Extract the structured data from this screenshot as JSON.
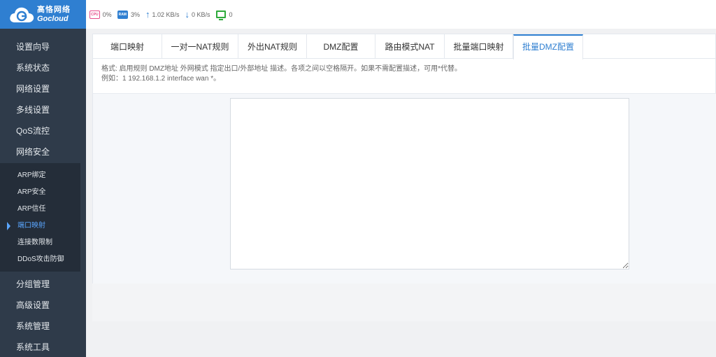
{
  "logo": {
    "cn": "高恪网络",
    "en": "Gocloud"
  },
  "status": {
    "cpu_tag": "CPU",
    "cpu": "0%",
    "ram_tag": "RAM",
    "ram": "3%",
    "up": "1.02 KB/s",
    "down": "0 KB/s",
    "devices": "0"
  },
  "sidebar": {
    "items_top": [
      "设置向导",
      "系统状态",
      "网络设置",
      "多线设置",
      "QoS流控",
      "网络安全"
    ],
    "sub_items": [
      "ARP绑定",
      "ARP安全",
      "ARP信任",
      "端口映射",
      "连接数限制",
      "DDoS攻击防御"
    ],
    "active_sub": "端口映射",
    "items_bottom": [
      "分组管理",
      "高级设置",
      "系统管理",
      "系统工具"
    ]
  },
  "tabs": [
    "端口映射",
    "一对一NAT规则",
    "外出NAT规则",
    "DMZ配置",
    "路由模式NAT",
    "批量端口映射",
    "批量DMZ配置"
  ],
  "active_tab": "批量DMZ配置",
  "hint": {
    "line1": "格式: 启用规则 DMZ地址 外网模式 指定出口/外部地址 描述。各项之间以空格隔开。如果不需配置描述，可用*代替。",
    "line2": "例如：1 192.168.1.2 interface wan *。"
  },
  "textarea": {
    "value": ""
  }
}
